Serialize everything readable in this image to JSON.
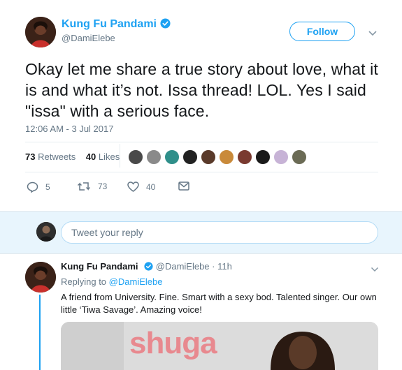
{
  "tweet": {
    "display_name": "Kung Fu Pandami",
    "handle": "@DamiElebe",
    "follow_label": "Follow",
    "text": "Okay let me share a true story about love, what it is and what it’s not. Issa thread! LOL. Yes I said \"issa\" with a serious face.",
    "timestamp": "12:06 AM - 3 Jul 2017",
    "retweets_count": "73",
    "retweets_label": "Retweets",
    "likes_count": "40",
    "likes_label": "Likes",
    "actions": {
      "replies": "5",
      "retweets": "73",
      "likes": "40"
    },
    "liker_avatar_count": 10
  },
  "reply_box": {
    "placeholder": "Tweet your reply"
  },
  "reply": {
    "display_name": "Kung Fu Pandami",
    "handle": "@DamiElebe",
    "separator": "·",
    "time": "11h",
    "replying_to_label": "Replying to",
    "replying_to_handle": "@DamiElebe",
    "text": "A friend from University. Fine. Smart with a sexy bod. Talented singer. Our own little ‘Tiwa Savage’. Amazing voice!",
    "media_text": "shuga"
  },
  "colors": {
    "accent": "#1da1f2",
    "text": "#14171a",
    "muted": "#657786",
    "reply_bar": "#e8f5fd"
  }
}
